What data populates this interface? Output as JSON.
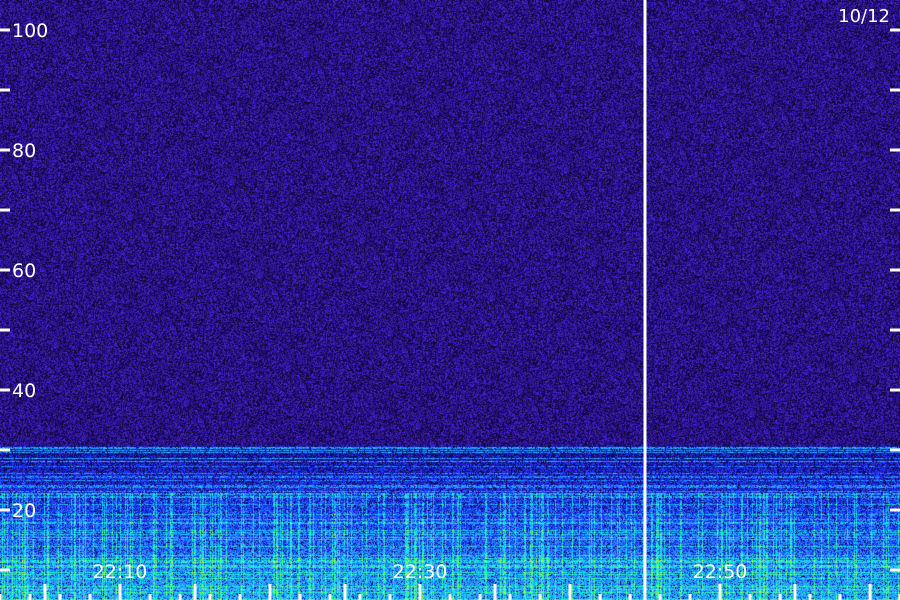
{
  "chart_data": {
    "type": "heatmap",
    "date_label": "10/12",
    "y_tick_labels": [
      "100",
      "80",
      "60",
      "40",
      "20"
    ],
    "y_ticks": [
      100,
      80,
      60,
      40,
      20
    ],
    "ylim": [
      0,
      110
    ],
    "x_time_labels": [
      "22:10",
      "22:30",
      "22:50"
    ],
    "minute_start": 2202,
    "minute_end": 2262,
    "x_label_minutes": [
      2210,
      2230,
      2250
    ],
    "gap_marker_minute": 2245,
    "background_color": "#1a0a50",
    "noise_colors": [
      "#12063a",
      "#2a1290",
      "#3a1cc0",
      "#4b2bd6"
    ],
    "band_colors": [
      "#0a0a60",
      "#1a3aff",
      "#2a8aff",
      "#19d3ff",
      "#2fff9a",
      "#a8ff40"
    ],
    "band_top_value": 30,
    "band_dense_value": 23,
    "tick_color": "#ffffff"
  }
}
